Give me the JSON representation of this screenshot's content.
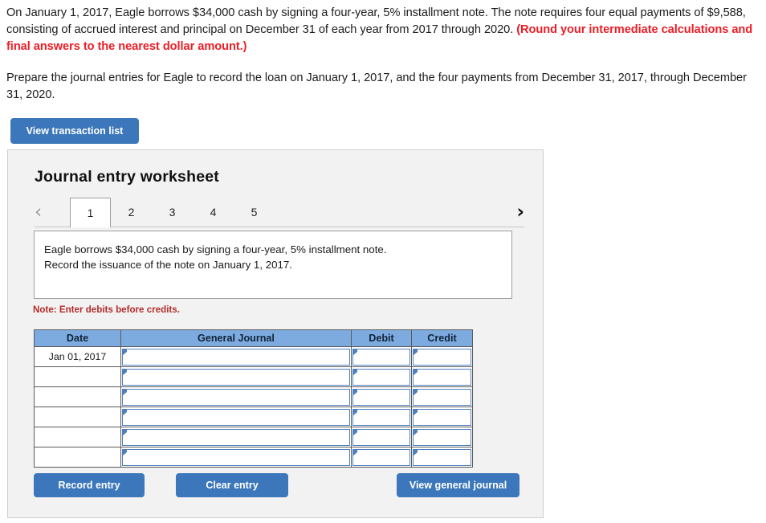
{
  "question": {
    "paragraph1_pre": "On January 1, 2017, Eagle borrows $34,000 cash by signing a four-year, 5% installment note. The note requires four equal payments of $9,588, consisting of accrued interest and principal on December 31 of each year from 2017 through 2020. ",
    "paragraph1_red": "(Round your intermediate calculations and final answers to the nearest dollar amount.)",
    "paragraph2": "Prepare the journal entries for Eagle to record the loan on January 1, 2017, and the four payments from December 31, 2017, through December 31, 2020."
  },
  "toolbar": {
    "view_transaction_list_label": "View transaction list"
  },
  "worksheet": {
    "title": "Journal entry worksheet",
    "tabs": [
      {
        "label": "1",
        "active": true
      },
      {
        "label": "2",
        "active": false
      },
      {
        "label": "3",
        "active": false
      },
      {
        "label": "4",
        "active": false
      },
      {
        "label": "5",
        "active": false
      }
    ],
    "prev_icon": "‹",
    "next_icon": "›",
    "description_line1": "Eagle borrows $34,000 cash by signing a four-year, 5% installment note.",
    "description_line2": "Record the issuance of the note on January 1, 2017.",
    "note": "Note: Enter debits before credits."
  },
  "table": {
    "headers": [
      "Date",
      "General Journal",
      "Debit",
      "Credit"
    ],
    "rows": [
      {
        "date": "Jan 01, 2017",
        "general_journal": "",
        "debit": "",
        "credit": ""
      },
      {
        "date": "",
        "general_journal": "",
        "debit": "",
        "credit": ""
      },
      {
        "date": "",
        "general_journal": "",
        "debit": "",
        "credit": ""
      },
      {
        "date": "",
        "general_journal": "",
        "debit": "",
        "credit": ""
      },
      {
        "date": "",
        "general_journal": "",
        "debit": "",
        "credit": ""
      },
      {
        "date": "",
        "general_journal": "",
        "debit": "",
        "credit": ""
      }
    ]
  },
  "footer": {
    "record_entry_label": "Record entry",
    "clear_entry_label": "Clear entry",
    "view_general_journal_label": "View general journal"
  },
  "colors": {
    "button_blue": "#3b77ba",
    "table_header_blue": "#7dabdf",
    "input_border_blue": "#4f80bd",
    "note_red": "#b52b2b",
    "emphasis_red": "#ee1c25",
    "panel_gray": "#f2f2f2"
  }
}
